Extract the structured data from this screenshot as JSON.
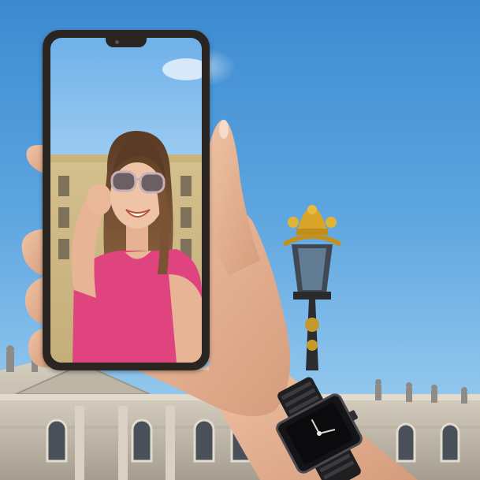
{
  "scene": {
    "description_items": [
      "sky",
      "palace-facade",
      "street-lamp",
      "hand-holding-phone",
      "wristwatch"
    ],
    "colors": {
      "sky_top": "#3c8ad0",
      "sky_bottom": "#a9d3f0",
      "stone": "#c9c2b4",
      "skin": "#e8b89a",
      "shirt": "#e0447e",
      "phone_frame": "#2b2522",
      "watch": "#1b1b1d",
      "gold": "#d9a427"
    }
  },
  "phone": {
    "screen_content": "selfie-preview"
  }
}
